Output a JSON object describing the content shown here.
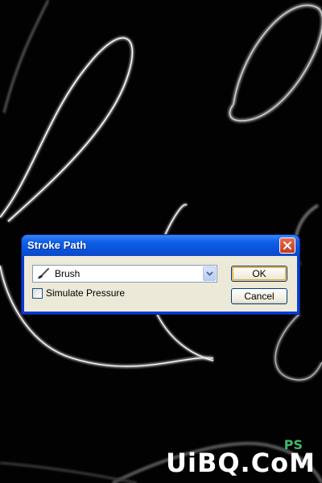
{
  "dialog": {
    "title": "Stroke Path",
    "tool_select": {
      "selected": "Brush",
      "icon": "brush-icon"
    },
    "simulate_pressure": {
      "label": "Simulate Pressure",
      "checked": false
    },
    "ok_label": "OK",
    "cancel_label": "Cancel"
  },
  "watermark": {
    "text": "UiBQ.CoM",
    "sub": "PS"
  },
  "colors": {
    "title_bar": "#0a52dc",
    "client_bg": "#ece9d8",
    "close_button": "#c5381c",
    "canvas_bg": "#020202"
  }
}
